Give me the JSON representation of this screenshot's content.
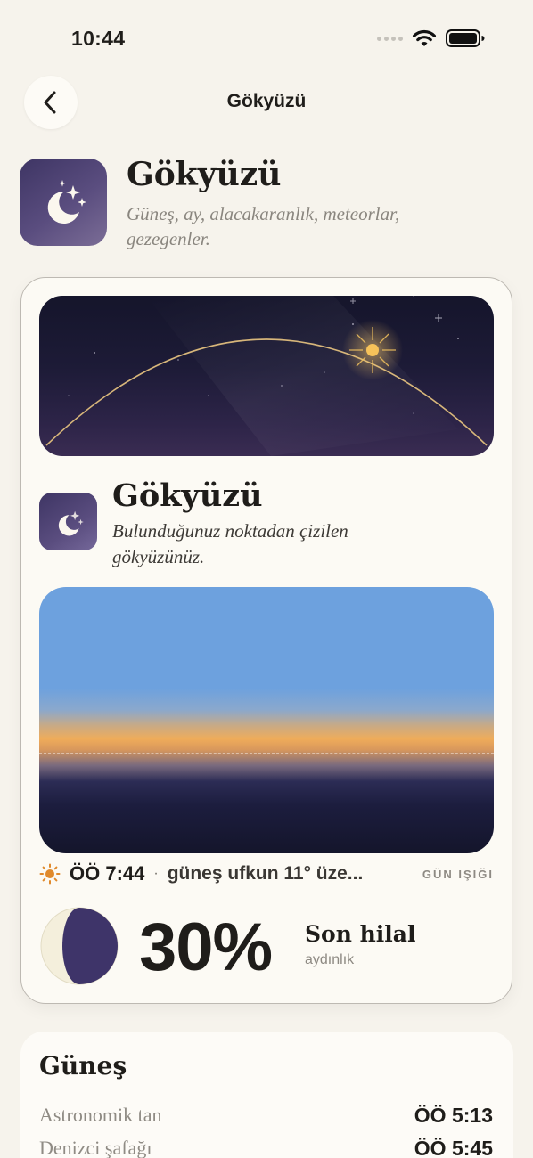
{
  "status_bar": {
    "time": "10:44"
  },
  "nav": {
    "title": "Gökyüzü"
  },
  "hero": {
    "title": "Gökyüzü",
    "subtitle": "Güneş, ay, alacakaranlık, meteorlar, gezegenler."
  },
  "card": {
    "title": "Gökyüzü",
    "subtitle": "Bulunduğunuz noktadan çizilen gökyüzünüz.",
    "sun_time": "ÖÖ 7:44",
    "separator": "·",
    "sun_detail": "güneş ufkun 11° üze...",
    "badge": "GÜN IŞIĞI",
    "moon": {
      "percent": "30%",
      "phase": "Son hilal",
      "lit_label": "aydınlık",
      "illumination": 0.3
    }
  },
  "sun_section": {
    "title": "Güneş",
    "rows": [
      {
        "label": "Astronomik tan",
        "value": "ÖÖ 5:13"
      },
      {
        "label": "Denizci şafağı",
        "value": "ÖÖ 5:45"
      }
    ]
  },
  "colors": {
    "background": "#f6f3ec",
    "icon_purple": "#4b4170",
    "sun_accent": "#f2b64a",
    "day_sky": "#6da1de"
  },
  "icons": {
    "back": "chevron-left-icon",
    "app": "moon-stars-icon",
    "sun": "sun-icon",
    "wifi": "wifi-icon",
    "battery": "battery-icon"
  }
}
